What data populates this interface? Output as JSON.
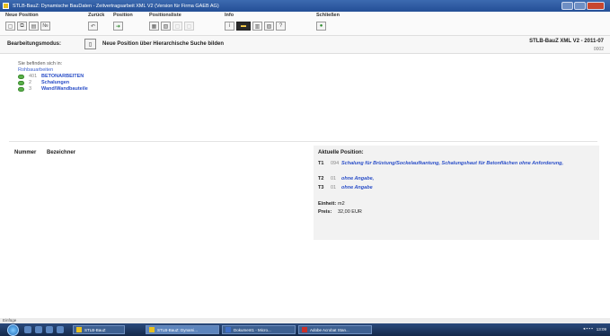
{
  "window": {
    "title": "STLB-BauZ: Dynamische BauDaten - Zeitvertragsarbeit XML V2 (Version für Firma GAEB AG)"
  },
  "toolbar": {
    "groups": [
      {
        "label": "Neue Position",
        "buttons": [
          "neu-icon",
          "kopie-icon",
          "text-icon",
          "nr-icon"
        ]
      },
      {
        "label": "Zurück",
        "buttons": [
          "undo-icon"
        ]
      },
      {
        "label": "Position",
        "buttons": [
          "position-icon"
        ]
      },
      {
        "label": "Positionsliste",
        "buttons": [
          "liste-icon",
          "liste-add-icon",
          "liste-dim-icon",
          "liste-dim2-icon"
        ]
      },
      {
        "label": "Info",
        "buttons": [
          "info-icon",
          "lizenz-icon",
          "doc-icon",
          "chart-icon",
          "help-icon"
        ]
      },
      {
        "label": "Schließen",
        "buttons": [
          "close-icon"
        ]
      }
    ]
  },
  "mode": {
    "label": "Bearbeitungsmodus:",
    "text": "Neue Position über Hierarchische Suche bilden",
    "version": "STLB-BauZ XML V2 - 2011-07",
    "subnum": "0002"
  },
  "breadcrumb": {
    "hint": "Sie befinden sich in:",
    "root": "Rohbauarbeiten",
    "items": [
      {
        "num": "401",
        "name": "BETONARBEITEN"
      },
      {
        "num": "2",
        "name": "Schalungen"
      },
      {
        "num": "3",
        "name": "Wand/Wandbauteile"
      }
    ]
  },
  "list": {
    "col_number": "Nummer",
    "col_name": "Bezeichner"
  },
  "current_position": {
    "heading": "Aktuelle Position:",
    "rows": [
      {
        "label": "T1",
        "code": "094",
        "value": "Schalung für Brüstung/Sockelaufkantung, Schalungshaut für Betonflächen ohne Anforderung,"
      },
      {
        "label": "T2",
        "code": "01",
        "value": "ohne Angabe,"
      },
      {
        "label": "T3",
        "code": "01",
        "value": "ohne Angabe"
      }
    ],
    "unit_label": "Einheit:",
    "unit_value": "m2",
    "price_label": "Preis:",
    "price_value": "32,00 EUR"
  },
  "status": {
    "text": "Einfüge"
  },
  "taskbar": {
    "tasks": [
      {
        "label": "STLB-BauZ"
      },
      {
        "label": "STLB-BauZ: Dynami..."
      },
      {
        "label": "Dokument1 - Micro..."
      },
      {
        "label": "Adobe Acrobat Stan..."
      }
    ],
    "clock": "13:09"
  }
}
